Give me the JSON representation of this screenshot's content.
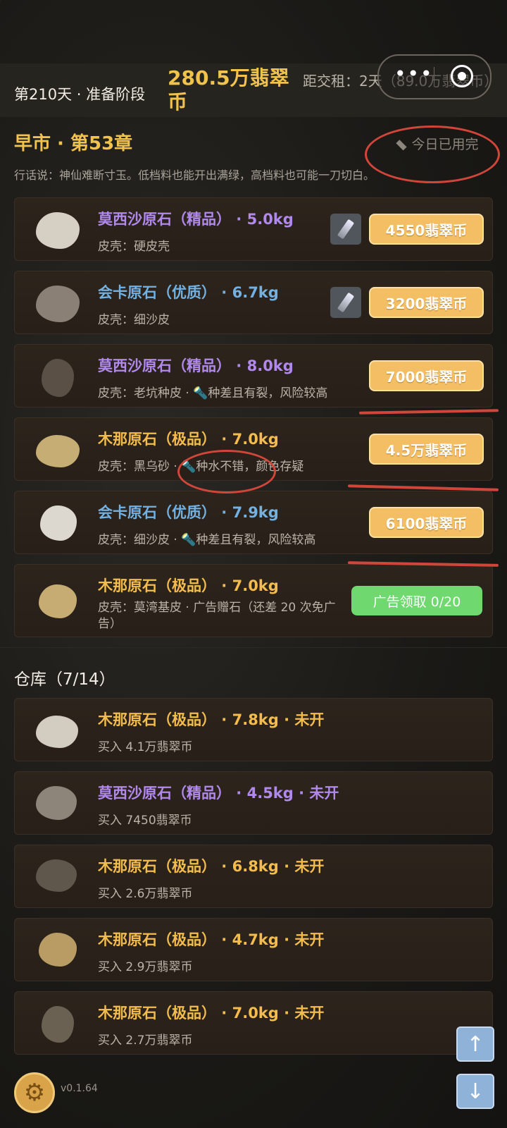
{
  "header": {
    "day_stage": "第210天 · 准备阶段",
    "coins": "280.5万翡翠币",
    "rent": "距交租：2天（89.0万翡翠币）",
    "capsule": {
      "more_icon": "more-dots-icon",
      "close_icon": "record-circle-icon"
    }
  },
  "market": {
    "title": "早市 · 第53章",
    "torch_status": "今日已用完",
    "quote": "行话说：神仙难断寸玉。低档料也能开出满绿，高档料也可能一刀切白。",
    "items": [
      {
        "name": "莫西沙原石（精品） · 5.0kg",
        "sub": "皮壳：硬皮壳",
        "price": "4550翡翠币",
        "has_torch": true,
        "name_color": "#b189ec",
        "stone_color": "#d5cfc4"
      },
      {
        "name": "会卡原石（优质） · 6.7kg",
        "sub": "皮壳：细沙皮",
        "price": "3200翡翠币",
        "has_torch": true,
        "name_color": "#72b1e2",
        "stone_color": "#8a8076"
      },
      {
        "name": "莫西沙原石（精品） · 8.0kg",
        "sub": "皮壳：老坑种皮 · 🔦种差且有裂，风险较高",
        "price": "7000翡翠币",
        "has_torch": false,
        "name_color": "#b189ec",
        "stone_color": "#5a5045"
      },
      {
        "name": "木那原石（极品） · 7.0kg",
        "sub": "皮壳：黑乌砂 · 🔦种水不错，颜色存疑",
        "price": "4.5万翡翠币",
        "has_torch": false,
        "name_color": "#f3bc4c",
        "stone_color": "#c5ad74"
      },
      {
        "name": "会卡原石（优质） · 7.9kg",
        "sub": "皮壳：细沙皮 · 🔦种差且有裂，风险较高",
        "price": "6100翡翠币",
        "has_torch": false,
        "name_color": "#72b1e2",
        "stone_color": "#dcd7cf"
      },
      {
        "name": "木那原石（极品） · 7.0kg",
        "sub": "皮壳：莫湾基皮 · 广告赠石（还差 20 次免广告）",
        "ad_label": "广告领取 0/20",
        "name_color": "#f3bc4c",
        "stone_color": "#c6ac72"
      }
    ]
  },
  "warehouse": {
    "title": "仓库（7/14）",
    "items": [
      {
        "name": "木那原石（极品） · 7.8kg · 未开",
        "sub": "买入 4.1万翡翠币",
        "name_color": "#f3bc4c",
        "stone_color": "#d3ccc0"
      },
      {
        "name": "莫西沙原石（精品） · 4.5kg · 未开",
        "sub": "买入 7450翡翠币",
        "name_color": "#b189ec",
        "stone_color": "#8d847a"
      },
      {
        "name": "木那原石（极品） · 6.8kg · 未开",
        "sub": "买入 2.6万翡翠币",
        "name_color": "#f3bc4c",
        "stone_color": "#5f574c"
      },
      {
        "name": "木那原石（极品） · 4.7kg · 未开",
        "sub": "买入 2.9万翡翠币",
        "name_color": "#f3bc4c",
        "stone_color": "#b99c63"
      },
      {
        "name": "木那原石（极品） · 7.0kg · 未开",
        "sub": "买入 2.7万翡翠币",
        "name_color": "#f3bc4c",
        "stone_color": "#6a6152"
      }
    ]
  },
  "footer": {
    "version": "v0.1.64",
    "settings_icon": "gear-icon",
    "scroll_up": "↑",
    "scroll_down": "↓"
  }
}
